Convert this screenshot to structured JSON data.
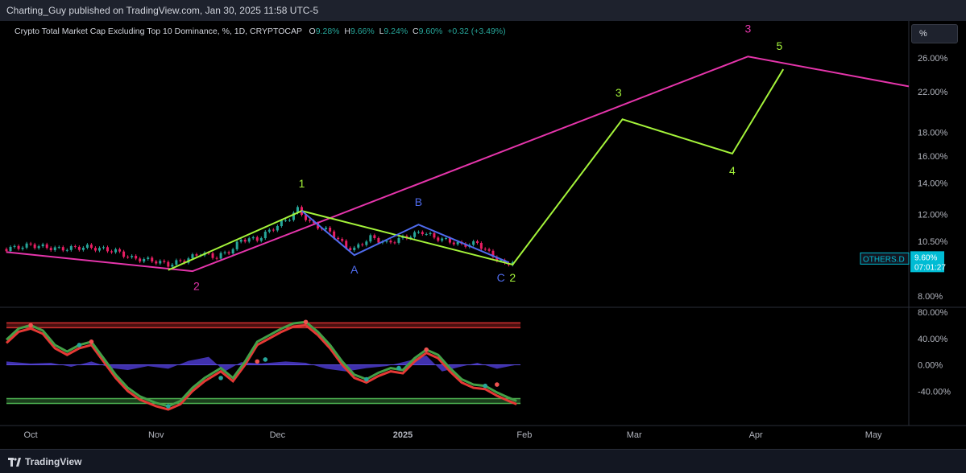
{
  "header": {
    "publisher_line": "Charting_Guy published on TradingView.com, Jan 30, 2025 11:58 UTC-5"
  },
  "legend": {
    "symbol_title": "Crypto Total Market Cap Excluding Top 10 Dominance, %, 1D, CRYPTOCAP",
    "open_label": "O",
    "open_value": "9.28%",
    "high_label": "H",
    "high_value": "9.66%",
    "low_label": "L",
    "low_value": "9.24%",
    "close_label": "C",
    "close_value": "9.60%",
    "change": "+0.32 (+3.49%)"
  },
  "scale_button": "%",
  "price_badge": {
    "ticker": "OTHERS.D",
    "value": "9.60%",
    "countdown": "07:01:27"
  },
  "footer": {
    "brand": "TradingView"
  },
  "colors": {
    "background": "#000000",
    "up_candle": "#26a69a",
    "down_candle": "#e91e63",
    "magenta_wave": "#e535ab",
    "green_wave": "#a4f33a",
    "blue_wave": "#4f6bed",
    "overbought_band": "#d32f2f",
    "oversold_band": "#4caf50",
    "momentum_fill": "#4b3acb",
    "badge": "#00bcd4"
  },
  "chart_data": [
    {
      "type": "candlestick",
      "title": "Crypto Total Market Cap Excluding Top 10 Dominance, %, 1D, CRYPTOCAP",
      "y_scale": "log",
      "y_ticks": [
        "26.00%",
        "22.00%",
        "18.00%",
        "16.00%",
        "14.00%",
        "12.00%",
        "10.50%",
        "8.00%"
      ],
      "x_ticks": [
        "Oct",
        "Nov",
        "Dec",
        "2025",
        "Feb",
        "Mar",
        "Apr",
        "May"
      ],
      "x_range": [
        "2024-09-25",
        "2025-05-10"
      ],
      "y_range": [
        7.6,
        31
      ],
      "close_series": [
        {
          "date": "2024-09-25",
          "close": 10.1
        },
        {
          "date": "2024-10-01",
          "close": 10.3
        },
        {
          "date": "2024-10-08",
          "close": 10.1
        },
        {
          "date": "2024-10-15",
          "close": 10.2
        },
        {
          "date": "2024-10-22",
          "close": 10.0
        },
        {
          "date": "2024-10-26",
          "close": 9.65
        },
        {
          "date": "2024-10-31",
          "close": 9.55
        },
        {
          "date": "2024-11-04",
          "close": 9.35
        },
        {
          "date": "2024-11-08",
          "close": 9.55
        },
        {
          "date": "2024-11-12",
          "close": 9.9
        },
        {
          "date": "2024-11-16",
          "close": 9.7
        },
        {
          "date": "2024-11-20",
          "close": 10.1
        },
        {
          "date": "2024-11-22",
          "close": 10.6
        },
        {
          "date": "2024-11-26",
          "close": 10.6
        },
        {
          "date": "2024-11-30",
          "close": 11.2
        },
        {
          "date": "2024-12-04",
          "close": 11.8
        },
        {
          "date": "2024-12-06",
          "close": 12.3
        },
        {
          "date": "2024-12-09",
          "close": 11.5
        },
        {
          "date": "2024-12-11",
          "close": 11.3
        },
        {
          "date": "2024-12-14",
          "close": 11.0
        },
        {
          "date": "2024-12-18",
          "close": 10.2
        },
        {
          "date": "2024-12-20",
          "close": 10.1
        },
        {
          "date": "2024-12-24",
          "close": 10.7
        },
        {
          "date": "2024-12-28",
          "close": 10.4
        },
        {
          "date": "2024-12-31",
          "close": 10.6
        },
        {
          "date": "2025-01-03",
          "close": 10.8
        },
        {
          "date": "2025-01-06",
          "close": 11.0
        },
        {
          "date": "2025-01-09",
          "close": 10.7
        },
        {
          "date": "2025-01-13",
          "close": 10.5
        },
        {
          "date": "2025-01-16",
          "close": 10.3
        },
        {
          "date": "2025-01-20",
          "close": 10.4
        },
        {
          "date": "2025-01-23",
          "close": 9.9
        },
        {
          "date": "2025-01-27",
          "close": 9.35
        },
        {
          "date": "2025-01-30",
          "close": 9.6
        }
      ],
      "wave_lines": [
        {
          "name": "magenta",
          "color": "#e535ab",
          "points": [
            {
              "date": "2024-09-25",
              "y": 9.95
            },
            {
              "date": "2024-11-10",
              "y": 9.05
            },
            {
              "date": "2025-03-30",
              "y": 26.2
            },
            {
              "date": "2025-05-10",
              "y": 22.6
            }
          ]
        },
        {
          "name": "green",
          "color": "#a4f33a",
          "points": [
            {
              "date": "2024-11-04",
              "y": 9.1
            },
            {
              "date": "2024-12-07",
              "y": 12.2
            },
            {
              "date": "2025-01-29",
              "y": 9.35
            },
            {
              "date": "2025-02-26",
              "y": 19.2
            },
            {
              "date": "2025-03-26",
              "y": 16.2
            },
            {
              "date": "2025-04-08",
              "y": 24.6
            }
          ]
        },
        {
          "name": "blue",
          "color": "#4f6bed",
          "points": [
            {
              "date": "2024-12-07",
              "y": 12.2
            },
            {
              "date": "2024-12-20",
              "y": 9.8
            },
            {
              "date": "2025-01-05",
              "y": 11.4
            },
            {
              "date": "2025-01-28",
              "y": 9.45
            }
          ]
        }
      ],
      "wave_labels": [
        {
          "text": "1",
          "color": "#a4f33a",
          "date": "2024-12-07",
          "y": 13.7
        },
        {
          "text": "2",
          "color": "#e535ab",
          "date": "2024-11-11",
          "y": 8.25
        },
        {
          "text": "A",
          "color": "#4f6bed",
          "date": "2024-12-20",
          "y": 8.95
        },
        {
          "text": "B",
          "color": "#4f6bed",
          "date": "2025-01-05",
          "y": 12.5
        },
        {
          "text": "C",
          "color": "#4f6bed",
          "date": "2025-01-26",
          "y": 8.6
        },
        {
          "text": "2",
          "color": "#a4f33a",
          "date": "2025-01-29",
          "y": 8.6
        },
        {
          "text": "3",
          "color": "#a4f33a",
          "date": "2025-02-25",
          "y": 21.5
        },
        {
          "text": "4",
          "color": "#a4f33a",
          "date": "2025-03-26",
          "y": 14.6
        },
        {
          "text": "3",
          "color": "#e535ab",
          "date": "2025-03-30",
          "y": 29.5
        },
        {
          "text": "5",
          "color": "#a4f33a",
          "date": "2025-04-07",
          "y": 27.1
        }
      ]
    },
    {
      "type": "line",
      "y_ticks": [
        "80.00%",
        "40.00%",
        "0.00%",
        "-40.00%"
      ],
      "y_range": [
        -80,
        80
      ],
      "overbought_level": 60,
      "oversold_level": -55,
      "oscillator": [
        {
          "date": "2024-09-25",
          "y": 38
        },
        {
          "date": "2024-09-28",
          "y": 55
        },
        {
          "date": "2024-10-01",
          "y": 60
        },
        {
          "date": "2024-10-04",
          "y": 52
        },
        {
          "date": "2024-10-07",
          "y": 30
        },
        {
          "date": "2024-10-10",
          "y": 20
        },
        {
          "date": "2024-10-13",
          "y": 30
        },
        {
          "date": "2024-10-16",
          "y": 35
        },
        {
          "date": "2024-10-19",
          "y": 10
        },
        {
          "date": "2024-10-22",
          "y": -15
        },
        {
          "date": "2024-10-25",
          "y": -35
        },
        {
          "date": "2024-10-28",
          "y": -48
        },
        {
          "date": "2024-11-01",
          "y": -58
        },
        {
          "date": "2024-11-04",
          "y": -63
        },
        {
          "date": "2024-11-07",
          "y": -55
        },
        {
          "date": "2024-11-10",
          "y": -35
        },
        {
          "date": "2024-11-13",
          "y": -20
        },
        {
          "date": "2024-11-17",
          "y": -5
        },
        {
          "date": "2024-11-20",
          "y": -20
        },
        {
          "date": "2024-11-23",
          "y": 5
        },
        {
          "date": "2024-11-26",
          "y": 35
        },
        {
          "date": "2024-11-29",
          "y": 45
        },
        {
          "date": "2024-12-02",
          "y": 55
        },
        {
          "date": "2024-12-05",
          "y": 63
        },
        {
          "date": "2024-12-08",
          "y": 65
        },
        {
          "date": "2024-12-11",
          "y": 50
        },
        {
          "date": "2024-12-14",
          "y": 30
        },
        {
          "date": "2024-12-17",
          "y": 5
        },
        {
          "date": "2024-12-20",
          "y": -15
        },
        {
          "date": "2024-12-23",
          "y": -22
        },
        {
          "date": "2024-12-26",
          "y": -12
        },
        {
          "date": "2024-12-29",
          "y": -5
        },
        {
          "date": "2025-01-01",
          "y": -8
        },
        {
          "date": "2025-01-04",
          "y": 10
        },
        {
          "date": "2025-01-07",
          "y": 23
        },
        {
          "date": "2025-01-10",
          "y": 15
        },
        {
          "date": "2025-01-13",
          "y": -5
        },
        {
          "date": "2025-01-16",
          "y": -22
        },
        {
          "date": "2025-01-19",
          "y": -30
        },
        {
          "date": "2025-01-22",
          "y": -32
        },
        {
          "date": "2025-01-25",
          "y": -42
        },
        {
          "date": "2025-01-28",
          "y": -50
        },
        {
          "date": "2025-01-30",
          "y": -55
        }
      ],
      "momentum": [
        {
          "date": "2024-09-25",
          "y": 5
        },
        {
          "date": "2024-10-01",
          "y": 2
        },
        {
          "date": "2024-10-06",
          "y": 3
        },
        {
          "date": "2024-10-11",
          "y": -3
        },
        {
          "date": "2024-10-16",
          "y": 5
        },
        {
          "date": "2024-10-21",
          "y": -5
        },
        {
          "date": "2024-10-25",
          "y": -8
        },
        {
          "date": "2024-10-30",
          "y": -2
        },
        {
          "date": "2024-11-04",
          "y": -6
        },
        {
          "date": "2024-11-09",
          "y": 6
        },
        {
          "date": "2024-11-14",
          "y": 12
        },
        {
          "date": "2024-11-18",
          "y": -10
        },
        {
          "date": "2024-11-22",
          "y": 4
        },
        {
          "date": "2024-11-27",
          "y": 2
        },
        {
          "date": "2024-12-03",
          "y": 5
        },
        {
          "date": "2024-12-08",
          "y": 3
        },
        {
          "date": "2024-12-13",
          "y": -6
        },
        {
          "date": "2024-12-18",
          "y": -10
        },
        {
          "date": "2024-12-23",
          "y": -5
        },
        {
          "date": "2024-12-28",
          "y": -2
        },
        {
          "date": "2025-01-03",
          "y": 7
        },
        {
          "date": "2025-01-07",
          "y": 14
        },
        {
          "date": "2025-01-11",
          "y": -10
        },
        {
          "date": "2025-01-15",
          "y": -4
        },
        {
          "date": "2025-01-20",
          "y": 3
        },
        {
          "date": "2025-01-25",
          "y": -6
        },
        {
          "date": "2025-01-30",
          "y": 0
        }
      ],
      "signal_dots": [
        {
          "date": "2024-10-01",
          "y": 60,
          "color": "#ef5350"
        },
        {
          "date": "2024-10-13",
          "y": 30,
          "color": "#26a69a"
        },
        {
          "date": "2024-10-16",
          "y": 35,
          "color": "#ef5350"
        },
        {
          "date": "2024-11-04",
          "y": -63,
          "color": "#26a69a"
        },
        {
          "date": "2024-11-17",
          "y": -20,
          "color": "#26a69a"
        },
        {
          "date": "2024-11-26",
          "y": 5,
          "color": "#ef5350"
        },
        {
          "date": "2024-11-28",
          "y": 8,
          "color": "#26a69a"
        },
        {
          "date": "2024-12-08",
          "y": 65,
          "color": "#ef5350"
        },
        {
          "date": "2024-12-23",
          "y": -22,
          "color": "#26a69a"
        },
        {
          "date": "2024-12-31",
          "y": -5,
          "color": "#26a69a"
        },
        {
          "date": "2025-01-07",
          "y": 23,
          "color": "#ef5350"
        },
        {
          "date": "2025-01-22",
          "y": -32,
          "color": "#26a69a"
        },
        {
          "date": "2025-01-25",
          "y": -30,
          "color": "#ef5350"
        }
      ]
    }
  ]
}
